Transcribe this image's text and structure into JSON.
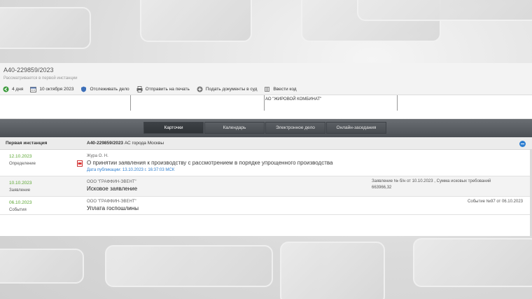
{
  "case": {
    "number": "А40-229859/2023",
    "status": "Рассматривается в первой инстанции"
  },
  "toolbar": {
    "items": [
      {
        "icon": "back-arrow-icon",
        "label": "4 дня"
      },
      {
        "icon": "calendar-icon",
        "label": "10 октября 2023"
      },
      {
        "icon": "shield-icon",
        "label": "Отслеживать дело"
      },
      {
        "icon": "printer-icon",
        "label": "Отправить на печать"
      },
      {
        "icon": "plus-circle-icon",
        "label": "Подать документы в суд"
      },
      {
        "icon": "book-icon",
        "label": "Ввести код"
      }
    ]
  },
  "participants": {
    "visible_name": "АО \"ЖИРОВОЙ КОМБИНАТ\""
  },
  "tabs": [
    {
      "label": "Карточки",
      "active": true
    },
    {
      "label": "Календарь",
      "active": false
    },
    {
      "label": "Электронное дело",
      "active": false
    },
    {
      "label": "Онлайн-заседания",
      "active": false
    }
  ],
  "instance": {
    "title": "Первая инстанция",
    "case_number": "А40-229859/2023",
    "court": "АС города Москвы"
  },
  "events": [
    {
      "date": "12.10.2023",
      "type": "Определение",
      "author": "Жура О. Н.",
      "title": "О принятии заявления к производству с рассмотрением в порядке упрощенного производства",
      "publication": "Дата публикации: 13.10.2023 г. 16:37:03 МСК",
      "has_document": true
    },
    {
      "date": "10.10.2023",
      "type": "Заявление",
      "author": "ООО \"ГРАФФИН-ЭВЕНТ\"",
      "title": "Исковое заявление",
      "info_line1": "Заявление № б/н от 10.10.2023 , Сумма исковых требований",
      "info_line2": "663966,32"
    },
    {
      "date": "06.10.2023",
      "type": "События",
      "author": "ООО \"ГРАФФИН-ЭВЕНТ\"",
      "title": "Уплата госпошлины",
      "info_right": "Событие №97 от 06.10.2023"
    }
  ],
  "colors": {
    "date_green": "#5aa530",
    "link_blue": "#2f7fd0",
    "tabbar_dark": "#4c5055"
  }
}
